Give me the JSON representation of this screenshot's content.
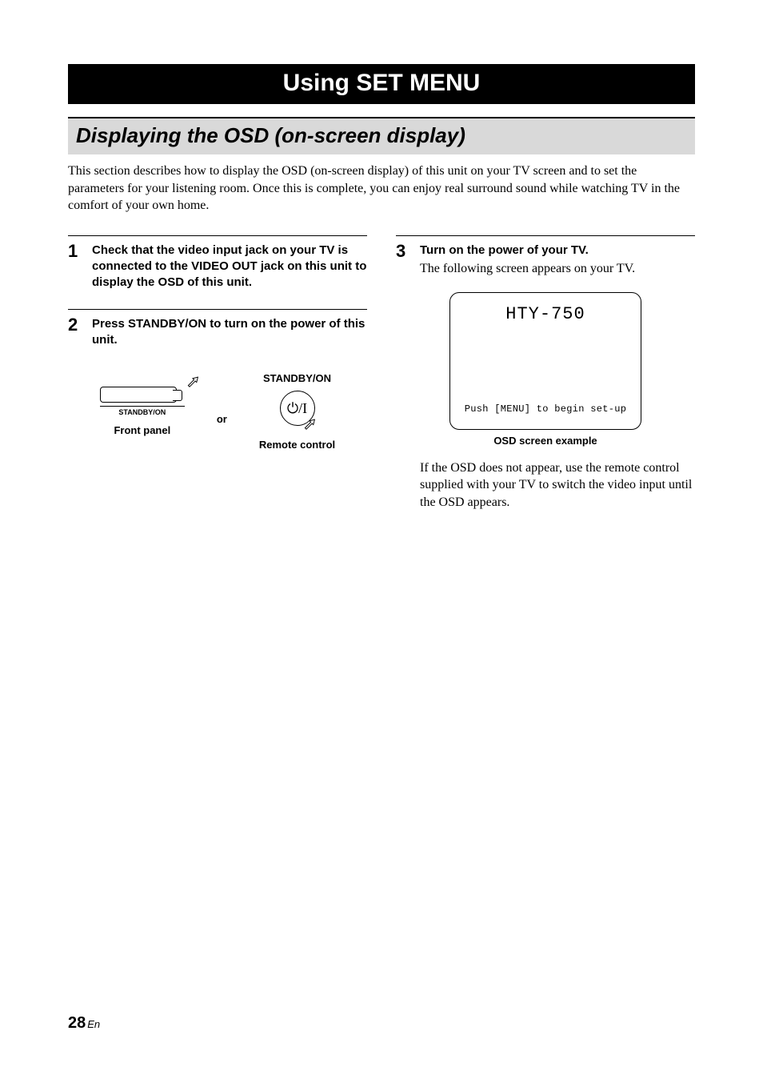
{
  "chapter": {
    "title": "Using SET MENU"
  },
  "section": {
    "title": "Displaying the OSD (on-screen display)"
  },
  "intro": "This section describes how to display the OSD (on-screen display) of this unit on your TV screen and to set the parameters for your listening room. Once this is complete, you can enjoy real surround sound while watching TV in the comfort of your own home.",
  "steps": {
    "s1": {
      "num": "1",
      "text": "Check that the video input jack on your TV is connected to the VIDEO OUT jack on this unit to display the OSD of this unit."
    },
    "s2": {
      "num": "2",
      "text": "Press STANDBY/ON to turn on the power of this unit.",
      "illust": {
        "front_small_label": "STANDBY/ON",
        "front_caption": "Front panel",
        "or": "or",
        "remote_top_label": "STANDBY/ON",
        "remote_caption": "Remote control",
        "power_glyph": "⏻/I"
      }
    },
    "s3": {
      "num": "3",
      "text": "Turn on the power of your TV.",
      "subtext": "The following screen appears on your TV.",
      "osd": {
        "model": "HTY-750",
        "prompt": "Push [MENU] to begin set-up",
        "caption": "OSD screen example"
      },
      "after": "If the OSD does not appear, use the remote control supplied with your TV to switch the video input until the OSD appears."
    }
  },
  "footer": {
    "page": "28",
    "lang": "En"
  }
}
